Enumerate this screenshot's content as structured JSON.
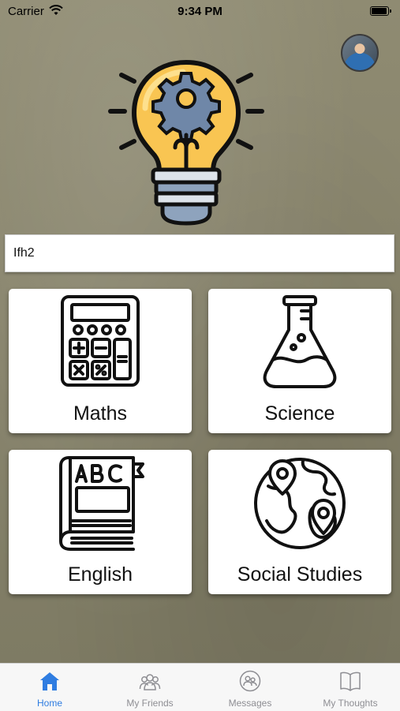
{
  "status_bar": {
    "carrier": "Carrier",
    "time": "9:34 PM"
  },
  "name_field": {
    "value": "Ifh2"
  },
  "subjects": [
    {
      "label": "Maths",
      "icon": "calculator-icon"
    },
    {
      "label": "Science",
      "icon": "flask-icon"
    },
    {
      "label": "English",
      "icon": "abc-book-icon"
    },
    {
      "label": "Social Studies",
      "icon": "globe-map-icon"
    }
  ],
  "tabs": [
    {
      "label": "Home",
      "icon": "home-icon",
      "active": true
    },
    {
      "label": "My Friends",
      "icon": "friends-icon",
      "active": false
    },
    {
      "label": "Messages",
      "icon": "messages-icon",
      "active": false
    },
    {
      "label": "My Thoughts",
      "icon": "book-icon",
      "active": false
    }
  ],
  "colors": {
    "accent": "#2f7de1",
    "tab_inactive": "#8e8e93",
    "bulb": "#f9c552"
  }
}
